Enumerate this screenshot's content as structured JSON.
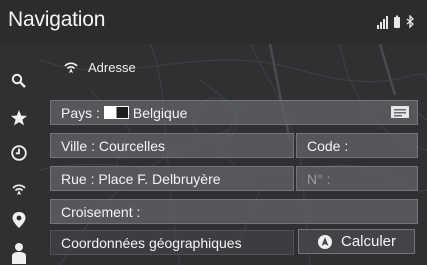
{
  "header": {
    "title": "Navigation",
    "status_icons": [
      "signal-icon",
      "battery-icon",
      "bluetooth-icon"
    ]
  },
  "sidebar": {
    "items": [
      {
        "icon": "search-icon"
      },
      {
        "icon": "star-icon"
      },
      {
        "icon": "clock-icon"
      },
      {
        "icon": "address-signal-icon"
      },
      {
        "icon": "location-pin-icon"
      },
      {
        "icon": "person-icon"
      }
    ]
  },
  "form": {
    "section_title": "Adresse",
    "country_label": "Pays :",
    "country_value": "Belgique",
    "city_label": "Ville :",
    "city_value": "Courcelles",
    "code_label": "Code :",
    "street_label": "Rue :",
    "street_value": "Place F. Delbruyère",
    "number_label": "N° :",
    "crossing_label": "Croisement :",
    "coordinates_label": "Coordonnées géographiques",
    "calculate_label": "Calculer"
  },
  "colors": {
    "background": "#2e2f31",
    "row": "#5e6064",
    "text": "#f4f4f4"
  }
}
